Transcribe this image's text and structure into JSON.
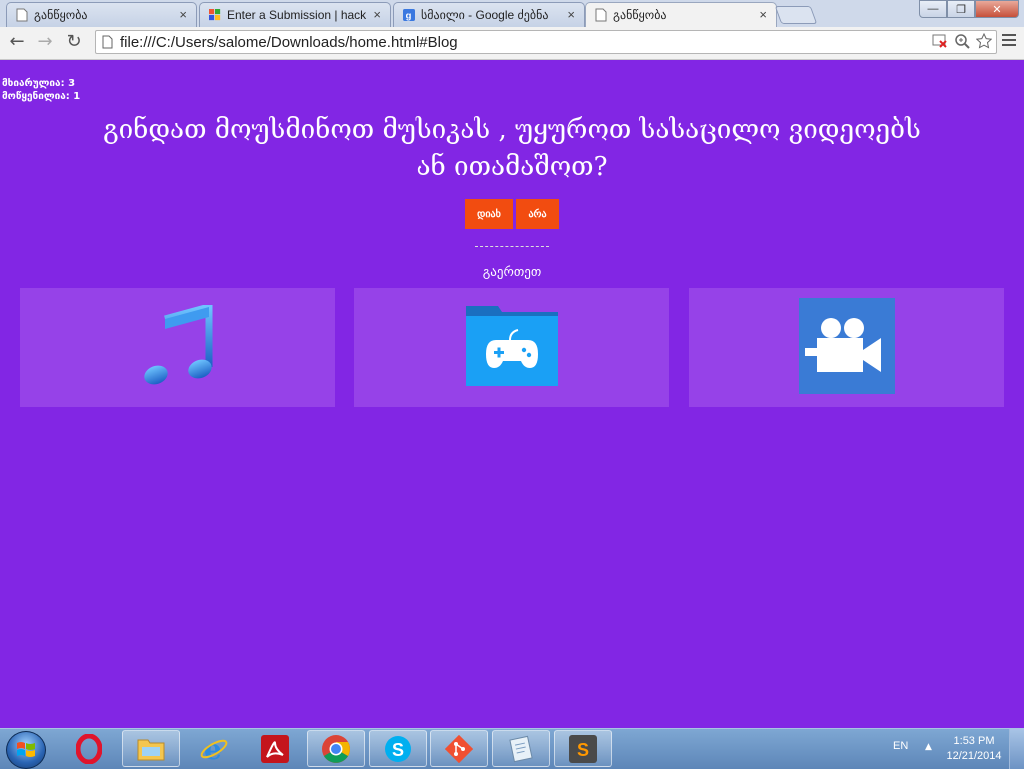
{
  "browser": {
    "tabs": [
      {
        "title": "განწყობა",
        "active": false,
        "icon": "page-icon"
      },
      {
        "title": "Enter a Submission | hack",
        "active": false,
        "icon": "hackpad-icon"
      },
      {
        "title": "სმაილი - Google ძებნა",
        "active": false,
        "icon": "google-icon"
      },
      {
        "title": "განწყობა",
        "active": true,
        "icon": "page-icon"
      }
    ],
    "url": "file:///C:/Users/salome/Downloads/home.html#Blog",
    "tab_close_glyph": "×",
    "window_controls": {
      "minimize": "—",
      "maximize": "❐",
      "close": "✕"
    }
  },
  "page": {
    "counters": {
      "line1": "მხიარულია: 3",
      "line2": "მოწყენილია: 1"
    },
    "headline": "გინდათ მოუსმინოთ მუსიკას , უყუროთ სასაცილო ვიდეოებს ან ითამაშოთ?",
    "buttons": {
      "yes": "დიახ",
      "no": "არა"
    },
    "section_label": "გაერთეთ",
    "cards": [
      {
        "name": "music",
        "icon": "music-note-icon"
      },
      {
        "name": "games",
        "icon": "game-folder-icon"
      },
      {
        "name": "videos",
        "icon": "video-camera-icon"
      }
    ],
    "colors": {
      "background": "#8226e4",
      "card": "#9642e8",
      "button": "#f24c10"
    }
  },
  "taskbar": {
    "items": [
      "opera-icon",
      "explorer-icon",
      "ie-icon",
      "acrobat-icon",
      "chrome-icon",
      "skype-icon",
      "git-icon",
      "notepad-icon",
      "sublime-icon"
    ],
    "language": "EN",
    "time": "1:53 PM",
    "date": "12/21/2014"
  }
}
